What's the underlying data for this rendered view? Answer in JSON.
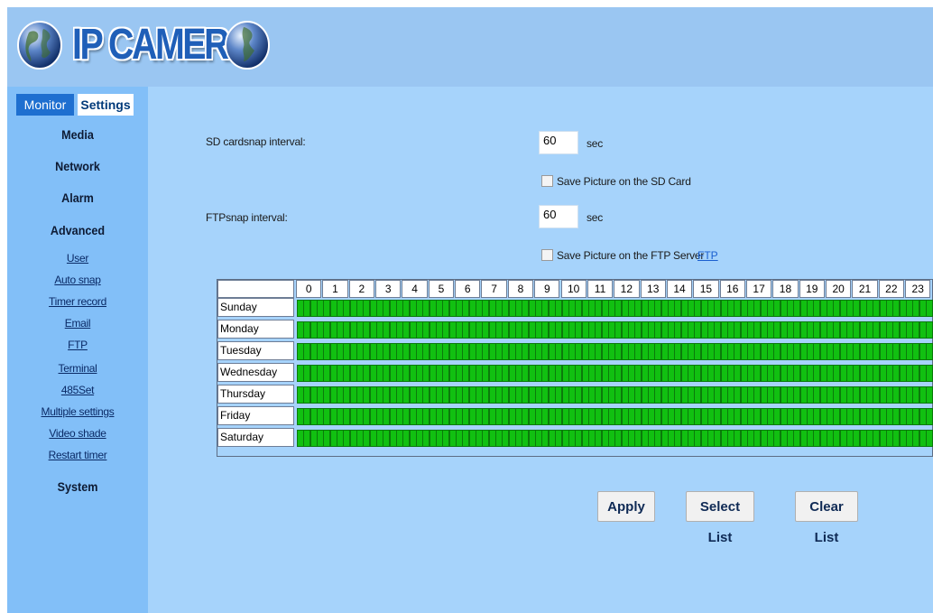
{
  "header": {
    "title": "IP CAMERA"
  },
  "tabs": [
    {
      "label": "Monitor",
      "active": false
    },
    {
      "label": "Settings",
      "active": true
    }
  ],
  "sidebar": {
    "sections": [
      "Media",
      "Network",
      "Alarm",
      "Advanced"
    ],
    "advanced_items": [
      "User",
      "Auto snap",
      "Timer record",
      "Email",
      "FTP",
      "Terminal",
      "485Set",
      "Multiple settings",
      "Video shade",
      "Restart timer"
    ],
    "last_section": "System"
  },
  "form": {
    "sd_label": "SD cardsnap interval:",
    "sd_value": "60",
    "sd_unit": "sec",
    "sd_checkbox_label": "Save Picture on the SD Card",
    "sd_checked": false,
    "ftp_label": "FTPsnap interval:",
    "ftp_value": "60",
    "ftp_unit": "sec",
    "ftp_checkbox_label": "Save Picture on the FTP Server",
    "ftp_checked": false,
    "ftp_link": "FTP"
  },
  "schedule": {
    "hours": [
      "0",
      "1",
      "2",
      "3",
      "4",
      "5",
      "6",
      "7",
      "8",
      "9",
      "10",
      "11",
      "12",
      "13",
      "14",
      "15",
      "16",
      "17",
      "18",
      "19",
      "20",
      "21",
      "22",
      "23"
    ],
    "days": [
      "Sunday",
      "Monday",
      "Tuesday",
      "Wednesday",
      "Thursday",
      "Friday",
      "Saturday"
    ],
    "slots_per_hour": 4,
    "all_selected": true,
    "selected_color": "#11c011"
  },
  "buttons": {
    "apply": "Apply",
    "select_list": "Select List",
    "clear_list": "Clear List"
  }
}
